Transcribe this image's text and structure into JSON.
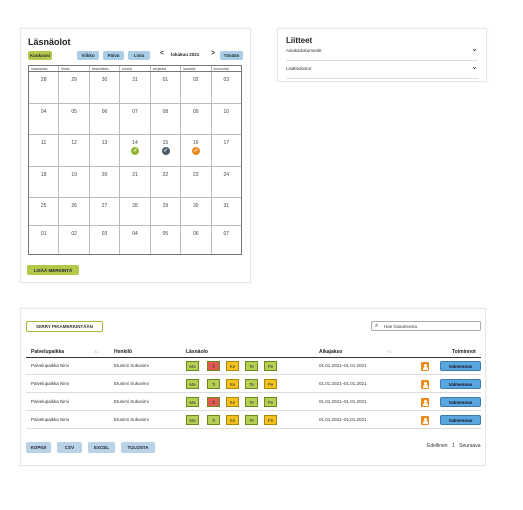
{
  "calendar": {
    "title": "Läsnäolot",
    "buttons": {
      "month": "Kuukausi",
      "week": "Viikko",
      "day": "Päivä",
      "list": "Lista",
      "today": "Tänään"
    },
    "prev_arrow": "<",
    "next_arrow": ">",
    "month_label": "lokakuu 2021",
    "weekdays": [
      "maanantai",
      "tiistai",
      "keskiviikko",
      "torstai",
      "perjantai",
      "lauantai",
      "sunnuntai"
    ],
    "weeks": [
      [
        "28",
        "29",
        "30",
        "31",
        "01",
        "02",
        "03"
      ],
      [
        "04",
        "05",
        "06",
        "07",
        "08",
        "09",
        "10"
      ],
      [
        "11",
        "12",
        "13",
        "14",
        "15",
        "16",
        "17"
      ],
      [
        "18",
        "19",
        "20",
        "21",
        "22",
        "23",
        "24"
      ],
      [
        "25",
        "26",
        "27",
        "28",
        "29",
        "30",
        "31"
      ],
      [
        "01",
        "02",
        "03",
        "04",
        "05",
        "06",
        "07"
      ]
    ],
    "status_icons": [
      {
        "week": 2,
        "day": 3,
        "icon": "check-circle-icon",
        "color": "#93b62e"
      },
      {
        "week": 2,
        "day": 4,
        "icon": "check-circle-icon",
        "color": "#4a5a68"
      },
      {
        "week": 2,
        "day": 5,
        "icon": "check-circle-icon",
        "color": "#ec8a1e"
      }
    ],
    "add_button": "LISÄÄ MERKINTÄ"
  },
  "attachments": {
    "title": "Liitteet",
    "items": [
      {
        "label": "Asiakadokumentit",
        "icon": "chevron-down-icon"
      },
      {
        "label": "Lisätiedostot",
        "icon": "chevron-down-icon"
      }
    ]
  },
  "table": {
    "move_button": "SIIRRY PIKAMERKINTÄÄN",
    "search_placeholder": "Hae listauksesta",
    "headers": {
      "place": "Palvelupaikka",
      "person": "Henkilö",
      "attendance": "Läsnäolo",
      "period": "Aikajakso",
      "actions": "Toiminnot"
    },
    "sort_glyph": "↑↓",
    "rows": [
      {
        "place": "Palvelupaikka Nimi",
        "person": "Etunimi Sukunimi",
        "days": [
          {
            "label": "Ma",
            "status": "green"
          },
          {
            "label": "Ti",
            "status": "red"
          },
          {
            "label": "Ke",
            "status": "yellow"
          },
          {
            "label": "Te",
            "status": "green"
          },
          {
            "label": "Pe",
            "status": "green"
          }
        ],
        "period": "01.01.2021–01.01.2021",
        "action": "Valmennus"
      },
      {
        "place": "Palvelupaikka Nimi",
        "person": "Etunimi Sukunimi",
        "days": [
          {
            "label": "Ma",
            "status": "green"
          },
          {
            "label": "Ti",
            "status": "green"
          },
          {
            "label": "Ke",
            "status": "yellow"
          },
          {
            "label": "Te",
            "status": "green"
          },
          {
            "label": "Pe",
            "status": "yellow"
          }
        ],
        "period": "01.01.2021–01.01.2021",
        "action": "Valmennus"
      },
      {
        "place": "Palvelupaikka Nimi",
        "person": "Etunimi Sukunimi",
        "days": [
          {
            "label": "Ma",
            "status": "green"
          },
          {
            "label": "Ti",
            "status": "red"
          },
          {
            "label": "Ke",
            "status": "yellow"
          },
          {
            "label": "Te",
            "status": "green"
          },
          {
            "label": "Pe",
            "status": "green"
          }
        ],
        "period": "01.01.2021–01.01.2021",
        "action": "Valmennus"
      },
      {
        "place": "Palvelupaikka Nimi",
        "person": "Etunimi Sukunimi",
        "days": [
          {
            "label": "Ma",
            "status": "green"
          },
          {
            "label": "Ti",
            "status": "green"
          },
          {
            "label": "Ke",
            "status": "yellow"
          },
          {
            "label": "Te",
            "status": "green"
          },
          {
            "label": "Pe",
            "status": "yellow"
          }
        ],
        "period": "01.01.2021–01.01.2021",
        "action": "Valmennus"
      }
    ],
    "export_buttons": [
      "KOPIOI",
      "CSV",
      "EXCEL",
      "TULOSTA"
    ],
    "pager": {
      "prev": "Edellinen",
      "page": "1",
      "next": "Seuraava"
    }
  },
  "colors": {
    "accent_green": "#b4c84a",
    "accent_blue": "#a9cde6",
    "action_blue": "#5aa6de",
    "status_green": "#b8cf56",
    "status_red": "#e05a50",
    "status_yellow": "#f3c21f",
    "person_orange": "#ec8a1e"
  }
}
